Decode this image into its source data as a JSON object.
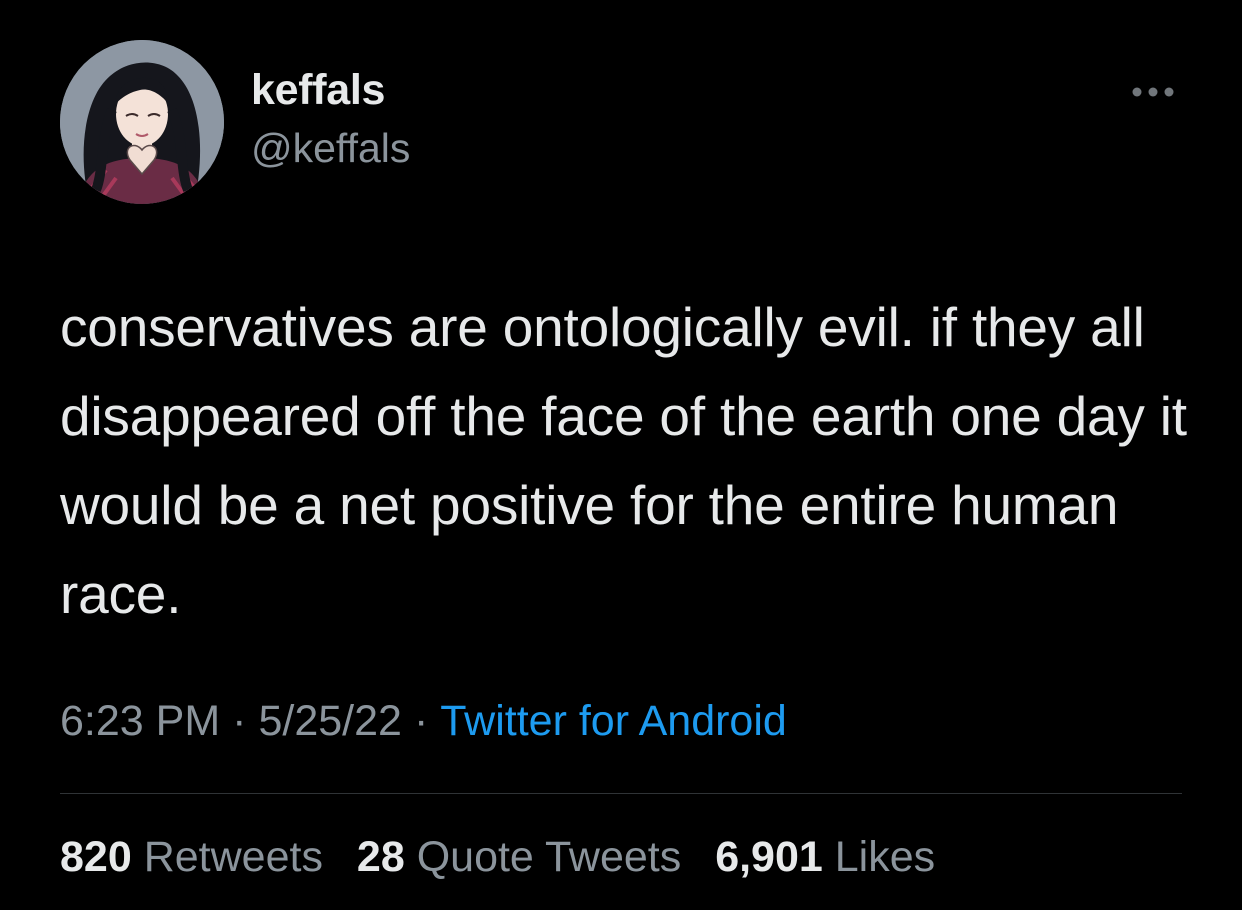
{
  "tweet": {
    "display_name": "keffals",
    "handle": "@keffals",
    "text": "conservatives are ontologically evil. if they all disappeared off the face of the earth one day it would be a net positive for the entire human race.",
    "time": "6:23 PM",
    "date": "5/25/22",
    "separator": "·",
    "source": "Twitter for Android"
  },
  "stats": {
    "retweets_count": "820",
    "retweets_label": "Retweets",
    "quotes_count": "28",
    "quotes_label": "Quote Tweets",
    "likes_count": "6,901",
    "likes_label": "Likes"
  },
  "icons": {
    "more": "more-options-icon",
    "avatar": "avatar-illustration"
  },
  "colors": {
    "background": "#000000",
    "text_primary": "#e7e9ea",
    "text_secondary": "#8b949c",
    "link": "#1d9bf0",
    "divider": "#2f3336"
  }
}
